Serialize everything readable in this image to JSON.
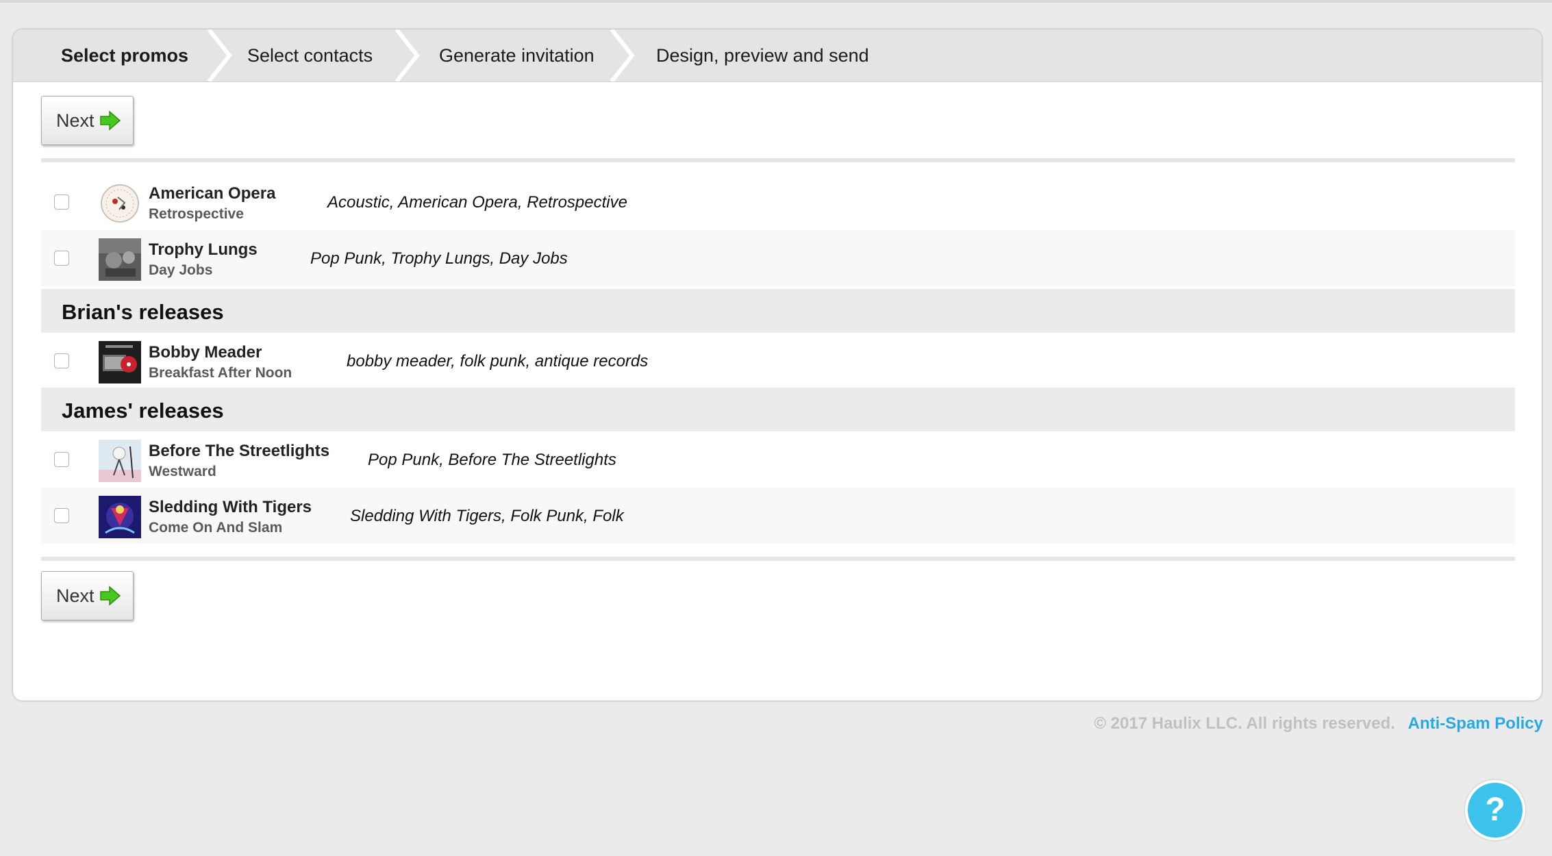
{
  "steps": [
    {
      "label": "Select promos",
      "active": true
    },
    {
      "label": "Select contacts",
      "active": false
    },
    {
      "label": "Generate invitation",
      "active": false
    },
    {
      "label": "Design, preview and send",
      "active": false
    }
  ],
  "buttons": {
    "next_label": "Next"
  },
  "groups": [
    {
      "title": ""
    },
    {
      "title": "Brian's releases"
    },
    {
      "title": "James' releases"
    }
  ],
  "releases": [
    {
      "artist": "American Opera",
      "album": "Retrospective",
      "tags": "Acoustic, American Opera, Retrospective",
      "checked": false
    },
    {
      "artist": "Trophy Lungs",
      "album": "Day Jobs",
      "tags": "Pop Punk, Trophy Lungs, Day Jobs",
      "checked": false
    },
    {
      "artist": "Bobby Meader",
      "album": "Breakfast After Noon",
      "tags": "bobby meader, folk punk, antique records",
      "checked": false
    },
    {
      "artist": "Before The Streetlights",
      "album": "Westward",
      "tags": "Pop Punk, Before The Streetlights",
      "checked": false
    },
    {
      "artist": "Sledding With Tigers",
      "album": "Come On And Slam",
      "tags": "Sledding With Tigers, Folk Punk, Folk",
      "checked": false
    }
  ],
  "footer": {
    "copyright": "© 2017 Haulix LLC. All rights reserved.",
    "link": "Anti-Spam Policy"
  },
  "help": {
    "label": "?"
  },
  "colors": {
    "accent": "#27a9e1",
    "help_bg": "#3dc2ec",
    "arrow": "#46c81e"
  }
}
